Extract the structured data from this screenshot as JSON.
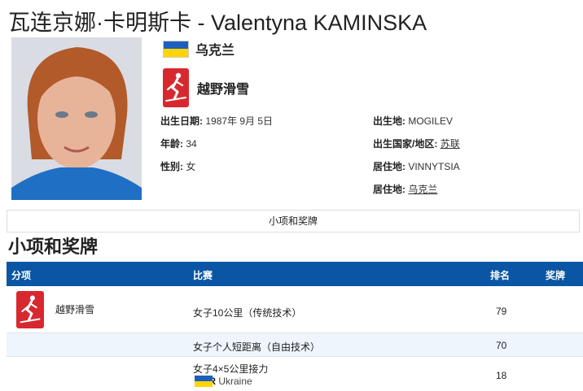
{
  "header": {
    "title": "瓦连京娜·卡明斯卡 - Valentyna KAMINSKA"
  },
  "athlete": {
    "country": "乌克兰",
    "sport": "越野滑雪",
    "dob_label": "出生日期:",
    "dob_value": "1987年 9月 5日",
    "age_label": "年龄:",
    "age_value": "34",
    "gender_label": "性别:",
    "gender_value": "女",
    "birthplace_label": "出生地:",
    "birthplace_value": "MOGILEV",
    "birth_country_label": "出生国家/地区:",
    "birth_country_value": "苏联",
    "residence_label": "居住地:",
    "residence_value": "VINNYTSIA",
    "residence_country_label": "居住地:",
    "residence_country_value": "乌克兰"
  },
  "tabs": {
    "events_medals": "小项和奖牌"
  },
  "section": {
    "title": "小项和奖牌"
  },
  "table": {
    "headers": {
      "discipline": "分项",
      "event": "比赛",
      "rank": "排名",
      "medal": "奖牌"
    },
    "discipline": "越野滑雪",
    "rows": [
      {
        "event": "女子10公里（传统技术）",
        "rank": "79"
      },
      {
        "event": "女子个人短距离（自由技术）",
        "rank": "70"
      },
      {
        "event": "女子4×5公里接力",
        "rank": "18",
        "team_code": "UKR",
        "team_name": "Ukraine"
      }
    ]
  },
  "colors": {
    "table_header": "#0b56a4",
    "pictogram": "#d8282f",
    "flag_blue": "#1d5fbf",
    "flag_yellow": "#ffd400"
  }
}
